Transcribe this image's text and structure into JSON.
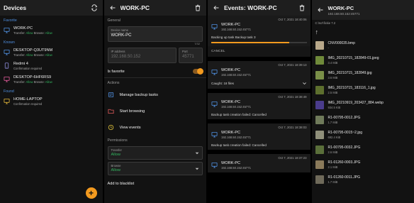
{
  "colors": {
    "accent_orange": "#f39a1f",
    "accent_blue": "#4f8fe0",
    "allow_green": "#33b55f"
  },
  "devices_panel": {
    "title": "Devices",
    "sections": {
      "favorite": "Favorite",
      "known": "Known",
      "found": "Found"
    },
    "favorite_devices": [
      {
        "name": "WORK-PC",
        "transfer_label": "Transfer: ",
        "transfer_value": "Allow",
        "browse_label": " Browse: ",
        "browse_value": "Allow",
        "icon": "monitor-icon"
      }
    ],
    "known_devices": [
      {
        "name": "DESKTOP-Q3UT9NM",
        "sub": "Transfer: Allow, Browse: Allow",
        "transfer_label": "Transfer: ",
        "transfer_value": "Allow",
        "browse_label": " Browse: ",
        "browse_value": "Allow",
        "icon": "monitor-icon"
      },
      {
        "name": "Redmi 4",
        "sub": "Confirmation required",
        "icon": "phone-icon"
      },
      {
        "name": "DESKTOP-6HF6RS9",
        "sub": "Transfer: Allow, Browse: Allow",
        "transfer_label": "Transfer: ",
        "transfer_value": "Allow",
        "browse_label": " Browse: ",
        "browse_value": "Allow",
        "icon": "monitor-icon"
      }
    ],
    "found_devices": [
      {
        "name": "HOME-LAPTOP",
        "sub": "Confirmation required",
        "icon": "monitor-icon"
      }
    ],
    "fab_symbol": "+"
  },
  "device_panel": {
    "title": "WORK-PC",
    "general_label": "General",
    "device_name_label": "Device name",
    "device_name_value": "WORK-PC",
    "device_name_counter": "7/32",
    "ip_label": "IP address",
    "ip_value": "192.168.50.152",
    "port_label": "Port",
    "port_value": "45771",
    "favorite_label": "Is favorite",
    "favorite_on": true,
    "actions_label": "Actions",
    "actions": [
      {
        "label": "Manage backup tasks",
        "icon": "backup-icon"
      },
      {
        "label": "Start browsing",
        "icon": "folder-icon"
      },
      {
        "label": "View events",
        "icon": "history-icon"
      }
    ],
    "permissions_label": "Permissions",
    "transfer_label": "Transfer",
    "transfer_value": "Allow",
    "browse_label": "Browse",
    "browse_value": "Allow",
    "blacklist_label": "Add to blacklist"
  },
  "events_panel": {
    "title": "Events: WORK-PC",
    "events": [
      {
        "date": "Oct 7, 2021 18:40:06",
        "title": "WORK-PC",
        "ip": "192.168.50.152:45771",
        "message": "Backing up task Backup task 3",
        "progress": 0.82,
        "cancel": "CANCEL"
      },
      {
        "date": "Oct 7, 2021 18:39:13",
        "title": "WORK-PC",
        "ip": "192.168.50.152:45771",
        "message": "Caught: 18 files",
        "expand": true
      },
      {
        "date": "Oct 7, 2021 18:38:49",
        "title": "WORK-PC",
        "ip": "192.168.50.152:45771",
        "message": "Backup task creation failed: Cancelled"
      },
      {
        "date": "Oct 7, 2021 18:38:03",
        "title": "WORK-PC",
        "ip": "192.168.50.152:45771",
        "message": "Backup task creation failed: Cancelled"
      },
      {
        "date": "Oct 7, 2021 18:37:23",
        "title": "WORK-PC",
        "ip": "192.168.50.152:45771",
        "message": ""
      }
    ]
  },
  "browse_panel": {
    "title": "WORK-PC",
    "subtitle": "192.168.50.152:45771",
    "path": "C:\\scr\\fickie 7.2",
    "up_symbol": "↑",
    "files": [
      {
        "name": "CNV000035.bmp",
        "size": "-",
        "thumb": "#b8a88a"
      },
      {
        "name": "IMG_20210715_182849-01.jpeg",
        "size": "3.4 MiB",
        "thumb": "#6f8a3a"
      },
      {
        "name": "IMG_20210715_182849.jpg",
        "size": "3.6 MiB",
        "thumb": "#7a8f48"
      },
      {
        "name": "IMG_20210715_183116_1.jpg",
        "size": "2.5 MiB",
        "thumb": "#5d6f2e"
      },
      {
        "name": "IMG_20210919_203427_884.webp",
        "size": "934.5 KiB",
        "thumb": "#4a3c8c"
      },
      {
        "name": "R1-00795-0012.JPG",
        "size": "1.7 MiB",
        "thumb": "#6f7a5a"
      },
      {
        "name": "R1-00795-0015~2.jpg",
        "size": "692.4 KiB",
        "thumb": "#8f8f7a"
      },
      {
        "name": "R1-00795-0032.JPG",
        "size": "2.6 MiB",
        "thumb": "#5a6f3a"
      },
      {
        "name": "R1-01260-0003.JPG",
        "size": "2.1 MiB",
        "thumb": "#8a7a5a"
      },
      {
        "name": "R1-01260-0011.JPG",
        "size": "1.7 MiB",
        "thumb": "#6f6a5a"
      }
    ]
  }
}
